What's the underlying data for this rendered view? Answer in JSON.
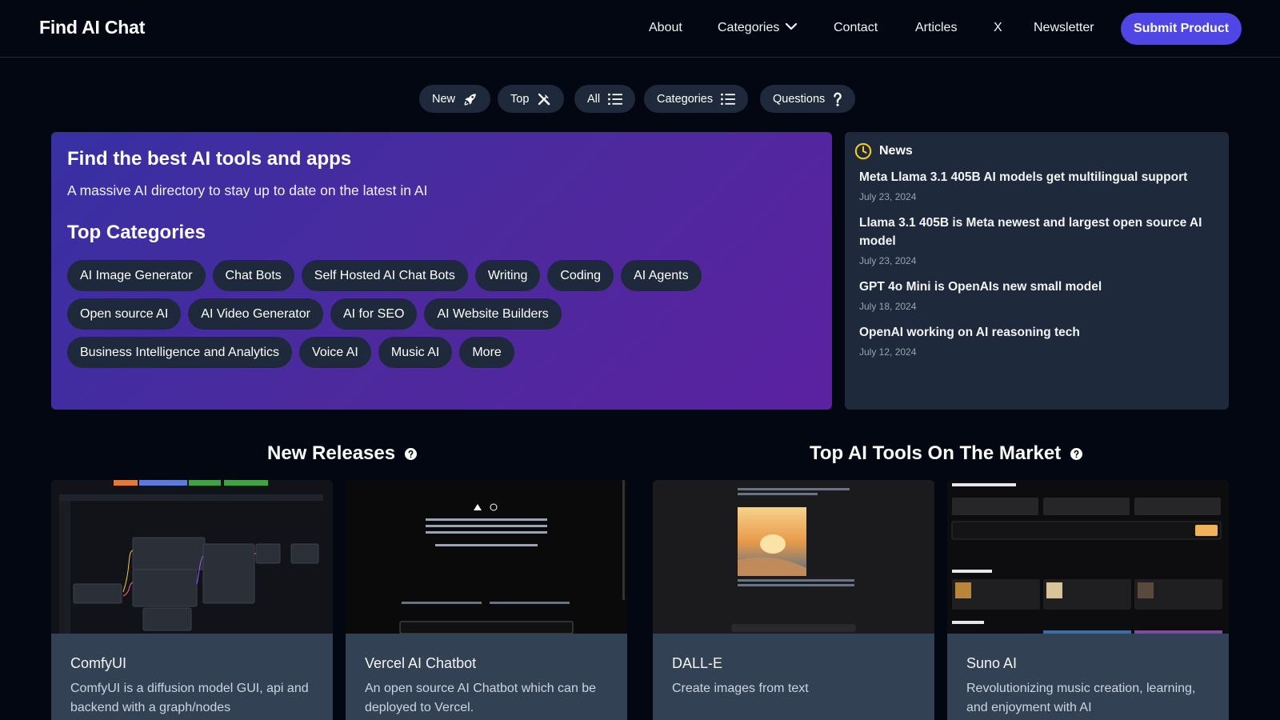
{
  "header": {
    "logo": "Find AI Chat",
    "nav": [
      "About",
      "Categories",
      "Contact",
      "Articles",
      "X",
      "Newsletter"
    ],
    "submit_label": "Submit Product"
  },
  "filters": [
    {
      "label": "New",
      "icon": "rocket-icon"
    },
    {
      "label": "Top",
      "icon": "tools-icon"
    },
    {
      "label": "All",
      "icon": "list-icon"
    },
    {
      "label": "Categories",
      "icon": "list-icon"
    },
    {
      "label": "Questions",
      "icon": "question-icon"
    }
  ],
  "hero": {
    "title": "Find the best AI tools and apps",
    "subtitle": "A massive AI directory to stay up to date on the latest in AI",
    "categories_title": "Top Categories",
    "categories": [
      [
        "AI Image Generator",
        "Chat Bots",
        "Self Hosted AI Chat Bots",
        "Writing",
        "Coding",
        "AI Agents"
      ],
      [
        "Open source AI",
        "AI Video Generator",
        "AI for SEO",
        "AI Website Builders"
      ],
      [
        "Business Intelligence and Analytics",
        "Voice AI",
        "Music AI",
        "More"
      ]
    ]
  },
  "news": {
    "heading": "News",
    "items": [
      {
        "title": "Meta Llama 3.1 405B AI models get multilingual support",
        "date": "July 23, 2024"
      },
      {
        "title": "Llama 3.1 405B is Meta newest and largest open source AI model",
        "date": "July 23, 2024"
      },
      {
        "title": "GPT 4o Mini is OpenAIs new small model",
        "date": "July 18, 2024"
      },
      {
        "title": "OpenAI working on AI reasoning tech",
        "date": "July 12, 2024"
      }
    ]
  },
  "sections": {
    "new_releases": "New Releases",
    "top_tools": "Top AI Tools On The Market"
  },
  "cards": [
    {
      "name": "ComfyUI",
      "desc": "ComfyUI is a diffusion model GUI, api and backend with a graph/nodes"
    },
    {
      "name": "Vercel AI Chatbot",
      "desc": "An open source AI Chatbot which can be deployed to Vercel."
    },
    {
      "name": "DALL-E",
      "desc": "Create images from text"
    },
    {
      "name": "Suno AI",
      "desc": "Revolutionizing music creation, learning, and enjoyment with AI"
    }
  ],
  "colors": {
    "accent": "#4f46e5",
    "background": "#030712",
    "pill": "#1e293b",
    "card": "#334155",
    "news_icon": "#facc15"
  }
}
